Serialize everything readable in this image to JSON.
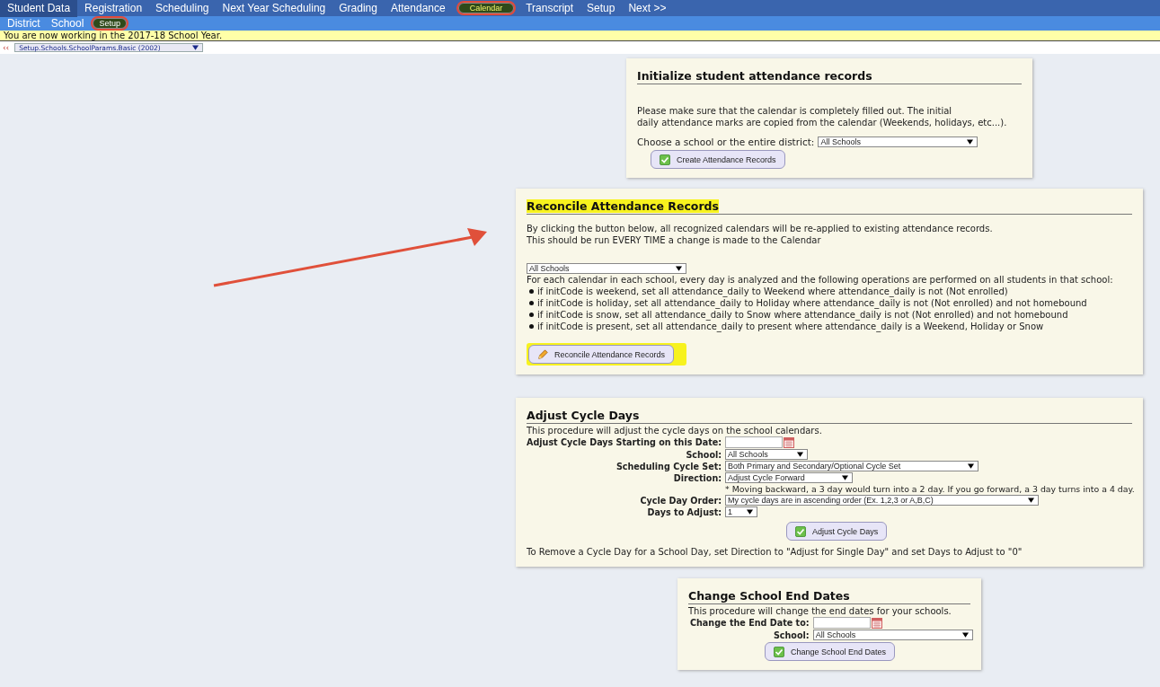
{
  "nav": {
    "items": [
      {
        "label": "Student Data",
        "selected": false,
        "circled": false
      },
      {
        "label": "Registration",
        "selected": false,
        "circled": false
      },
      {
        "label": "Scheduling",
        "selected": false,
        "circled": false
      },
      {
        "label": "Next Year Scheduling",
        "selected": false,
        "circled": false
      },
      {
        "label": "Grading",
        "selected": false,
        "circled": false
      },
      {
        "label": "Attendance",
        "selected": false,
        "circled": false
      },
      {
        "label": "Calendar",
        "selected": true,
        "circled": true
      },
      {
        "label": "Transcript",
        "selected": false,
        "circled": false
      },
      {
        "label": "Setup",
        "selected": false,
        "circled": false
      },
      {
        "label": "Next >>",
        "selected": false,
        "circled": false
      }
    ]
  },
  "subnav": {
    "items": [
      {
        "label": "District",
        "selected": false,
        "circled": false
      },
      {
        "label": "School",
        "selected": false,
        "circled": false
      },
      {
        "label": "Setup",
        "selected": true,
        "circled": true
      }
    ]
  },
  "banner": "You are now working in the 2017-18 School Year.",
  "page_picker": {
    "back": "‹‹",
    "value": "Setup.Schools.SchoolParams.Basic (2002)"
  },
  "init_panel": {
    "title": "Initialize student attendance records",
    "text_lines": [
      "Please make sure that the calendar is completely filled out. The initial",
      "daily attendance marks are copied from the calendar (Weekends, holidays, etc...)."
    ],
    "school_label": "Choose a school or the entire district:",
    "school_value": "All Schools",
    "button": "Create Attendance Records"
  },
  "reconcile_panel": {
    "title": "Reconcile Attendance Records",
    "title_highlighted": true,
    "text_lines": [
      "By clicking the button below, all recognized calendars will be re-applied to existing attendance records.",
      "This should be run EVERY TIME a change is made to the Calendar"
    ],
    "school_value": "All Schools",
    "intro": "For each calendar in each school, every day is analyzed and the following operations are performed on all students in that school:",
    "rules": [
      "if initCode is weekend, set all attendance_daily to Weekend where attendance_daily is not (Not enrolled)",
      "if initCode is holiday, set all attendance_daily to Holiday where attendance_daily is not (Not enrolled) and not homebound",
      "if initCode is snow, set all attendance_daily to Snow where attendance_daily is not (Not enrolled) and not homebound",
      "if initCode is present, set all attendance_daily to present where attendance_daily is a Weekend, Holiday or Snow"
    ],
    "button": "Reconcile Attendance Records",
    "button_highlighted": true
  },
  "cycle_panel": {
    "title": "Adjust Cycle Days",
    "description": "This procedure will adjust the cycle days on the school calendars.",
    "fields": [
      {
        "kind": "date",
        "label": "Adjust Cycle Days Starting on this Date:"
      },
      {
        "kind": "select",
        "label": "School:",
        "value": "All Schools"
      },
      {
        "kind": "select",
        "label": "Scheduling Cycle Set:",
        "value": "Both Primary and Secondary/Optional Cycle Set"
      },
      {
        "kind": "select",
        "label": "Direction:",
        "value": "Adjust Cycle Forward",
        "note": "* Moving backward, a 3 day would turn into a 2 day. If you go forward, a 3 day turns into a 4 day."
      },
      {
        "kind": "select",
        "label": "Cycle Day Order:",
        "value": "My cycle days are in ascending order (Ex. 1,2,3 or A,B,C)"
      },
      {
        "kind": "select",
        "label": "Days to Adjust:",
        "value": "1"
      }
    ],
    "button": "Adjust Cycle Days",
    "footer": "To Remove a Cycle Day for a School Day, set Direction to \"Adjust for Single Day\" and set Days to Adjust to \"0\""
  },
  "end_dates_panel": {
    "title": "Change School End Dates",
    "description": "This procedure will change the end dates for your schools.",
    "fields": [
      {
        "kind": "date",
        "label": "Change the End Date to:"
      },
      {
        "kind": "select",
        "label": "School:",
        "value": "All Schools"
      }
    ],
    "button": "Change School End Dates"
  }
}
